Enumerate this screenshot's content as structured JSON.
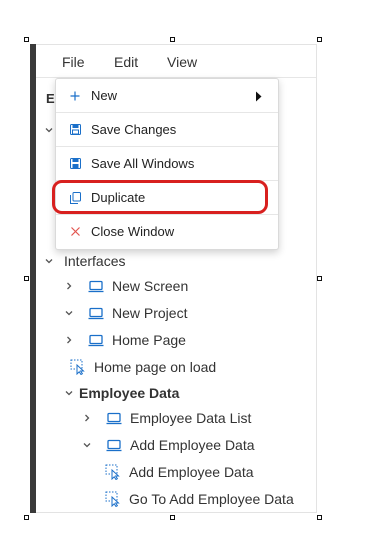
{
  "menubar": {
    "file": "File",
    "edit": "Edit",
    "view": "View"
  },
  "truncated_label": "E",
  "file_menu": {
    "items": [
      {
        "label": "New",
        "icon": "plus-icon",
        "submenu": true
      },
      {
        "label": "Save Changes",
        "icon": "save-icon"
      },
      {
        "label": "Save All Windows",
        "icon": "save-all-icon"
      },
      {
        "label": "Duplicate",
        "icon": "duplicate-icon",
        "highlighted": true
      },
      {
        "label": "Close Window",
        "icon": "close-icon"
      }
    ]
  },
  "tree": {
    "interfaces": "Interfaces",
    "new_screen": "New Screen",
    "new_project": "New Project",
    "home_page": "Home Page",
    "home_page_on_load": "Home page on load",
    "employee_data": "Employee Data",
    "employee_data_list": "Employee Data List",
    "add_employee_data": "Add Employee Data",
    "add_employee_data_action": "Add Employee Data",
    "go_to_add_employee_data": "Go To Add Employee Data"
  },
  "colors": {
    "accent": "#1a6fc9",
    "highlight_border": "#d8201f",
    "close_icon": "#e2554f",
    "sidebar_bar": "#3a3a3a"
  }
}
